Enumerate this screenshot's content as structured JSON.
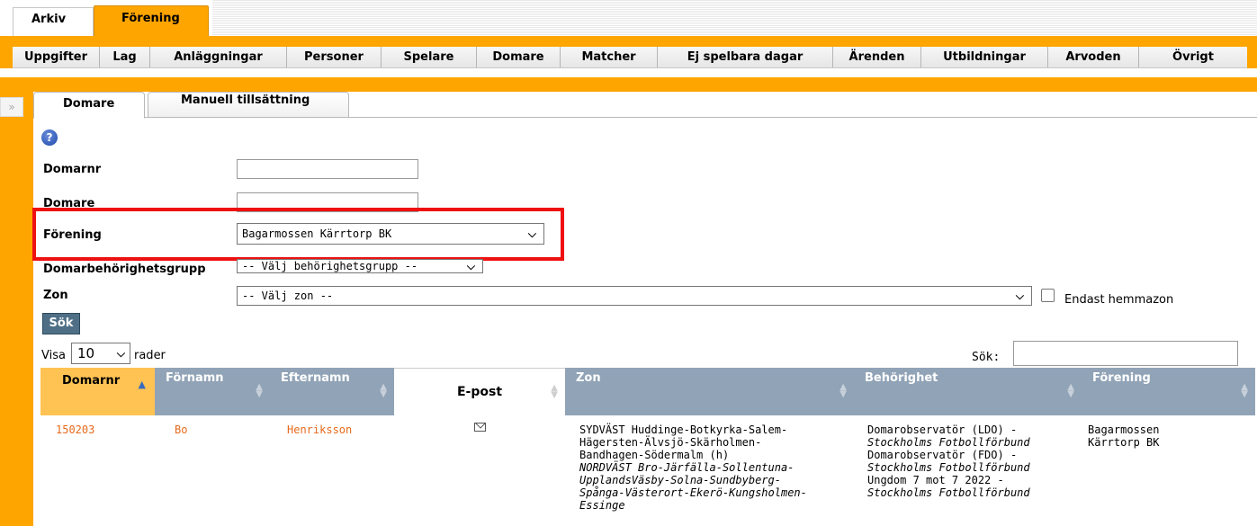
{
  "top_tabs": [
    {
      "label": "Arkiv"
    },
    {
      "label": "Förening"
    }
  ],
  "menu": [
    {
      "label": "Uppgifter"
    },
    {
      "label": "Lag"
    },
    {
      "label": "Anläggningar"
    },
    {
      "label": "Personer"
    },
    {
      "label": "Spelare"
    },
    {
      "label": "Domare"
    },
    {
      "label": "Matcher"
    },
    {
      "label": "Ej spelbara dagar"
    },
    {
      "label": "Ärenden"
    },
    {
      "label": "Utbildningar"
    },
    {
      "label": "Arvoden"
    },
    {
      "label": "Övrigt"
    }
  ],
  "collapse_glyph": "»",
  "subtabs": [
    {
      "label": "Domare"
    },
    {
      "label": "Manuell tillsättning"
    }
  ],
  "help_glyph": "?",
  "form": {
    "domarnr_label": "Domarnr",
    "domarnr_value": "",
    "domare_label": "Domare",
    "domare_value": "",
    "forening_label": "Förening",
    "forening_value": "Bagarmossen Kärrtorp BK",
    "behorighet_label": "Domarbehörighetsgrupp",
    "behorighet_value": "-- Välj behörighetsgrupp --",
    "zon_label": "Zon",
    "zon_value": "-- Välj zon --",
    "hemmazon_label": "Endast hemmazon",
    "sok_button": "Sök"
  },
  "table_controls": {
    "visa_label": "Visa",
    "visa_value": "10",
    "rader_label": "rader",
    "sok_label": "Sök:",
    "sok_value": ""
  },
  "table": {
    "columns": [
      "Domarnr",
      "Förnamn",
      "Efternamn",
      "E-post",
      "Zon",
      "Behörighet",
      "Förening"
    ],
    "rows": [
      {
        "domarnr": "150203",
        "fornamn": "Bo",
        "efternamn": "Henriksson",
        "zon_lines": [
          "SYDVÄST Huddinge-Botkyrka-Salem-",
          "Hägersten-Älvsjö-Skärholmen-",
          "Bandhagen-Södermalm (h)",
          "NORDVÄST Bro-Järfälla-Sollentuna-",
          "UpplandsVäsby-Solna-Sundbyberg-",
          "Spånga-Västerort-Ekerö-Kungsholmen-",
          "Essinge"
        ],
        "behorighet_lines": [
          "Domarobservatör (LDO) -",
          "Stockholms Fotbollförbund",
          "Domarobservatör (FDO) -",
          "Stockholms Fotbollförbund",
          "Ungdom 7 mot 7 2022 -",
          "Stockholms Fotbollförbund"
        ],
        "forening_lines": [
          "Bagarmossen",
          "Kärrtorp BK"
        ]
      }
    ]
  },
  "colors": {
    "accent": "#ffa500",
    "highlight": "#ee1111",
    "header_bg": "#91a3b6",
    "sorted_header": "#ffc354",
    "link": "#e6691b"
  }
}
